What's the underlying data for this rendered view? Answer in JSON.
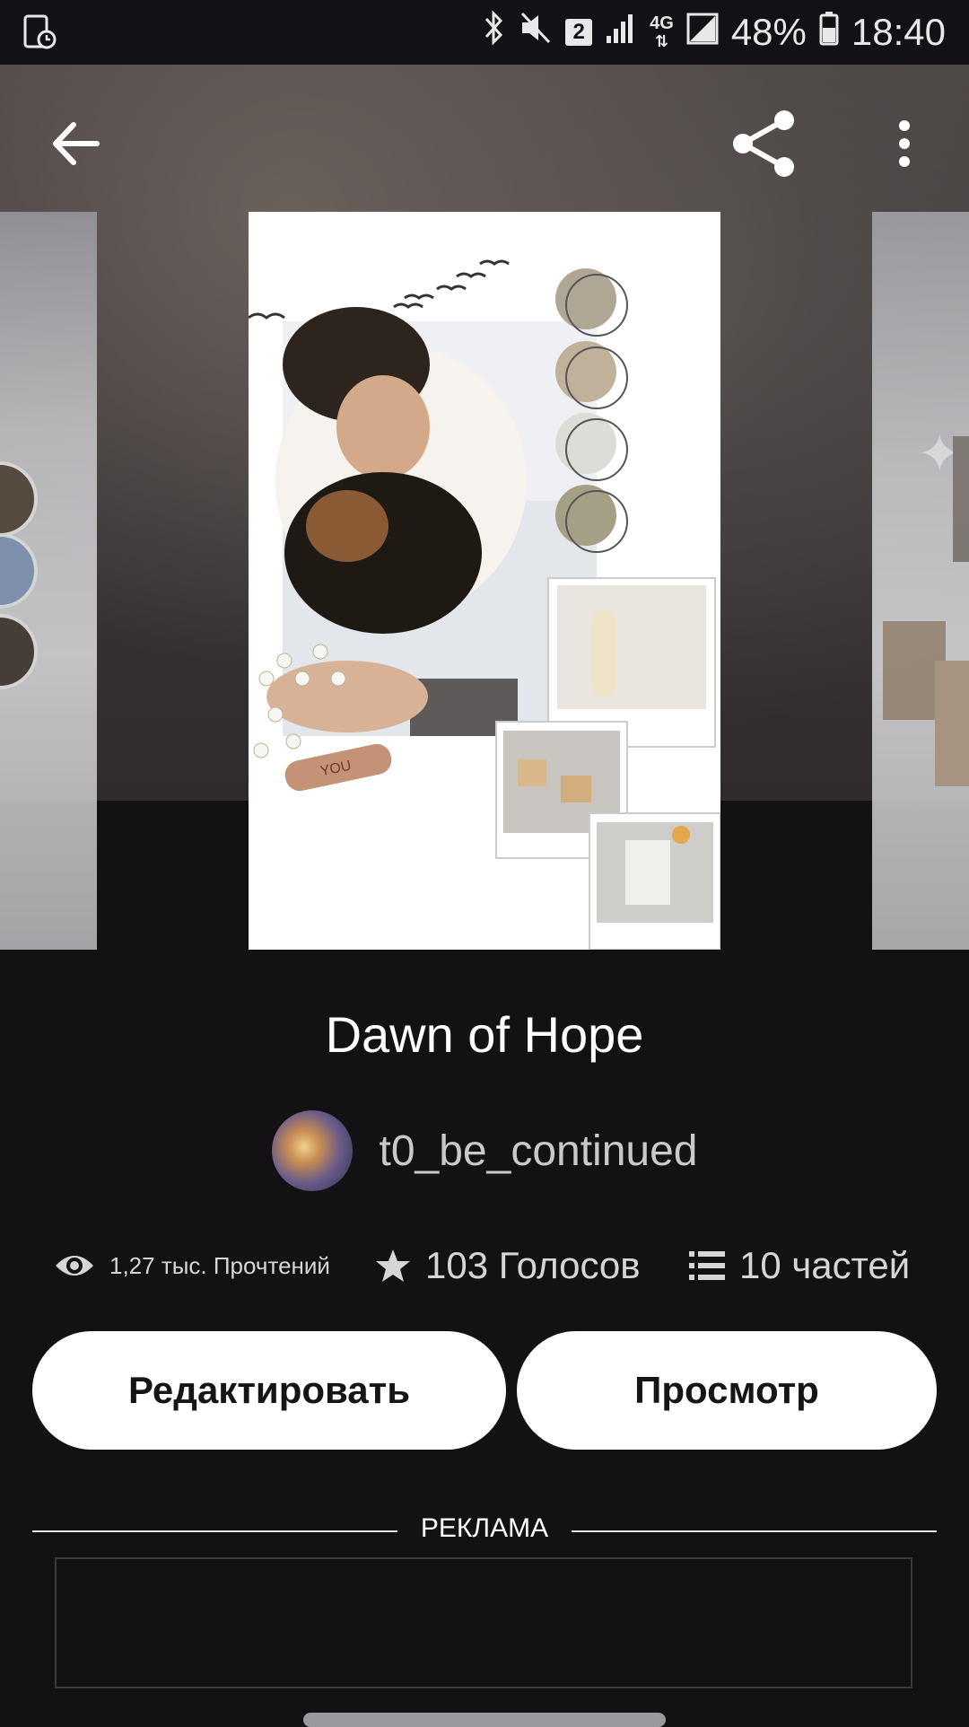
{
  "status_bar": {
    "sim": "2",
    "network": "4G",
    "battery": "48%",
    "time": "18:40"
  },
  "story": {
    "title": "Dawn of Hope",
    "author": "t0_be_continued",
    "reads": "1,27 тыс. Прочтений",
    "votes": "103 Голосов",
    "parts": "10 частей",
    "cover_sticker": "YOU"
  },
  "actions": {
    "edit_label": "Редактировать",
    "view_label": "Просмотр"
  },
  "ad": {
    "label": "РЕКЛАМА"
  },
  "icons": {
    "back": "back-arrow-icon",
    "share": "share-icon",
    "more": "more-vert-icon",
    "reads": "eye-icon",
    "votes": "star-icon",
    "parts": "list-icon"
  }
}
